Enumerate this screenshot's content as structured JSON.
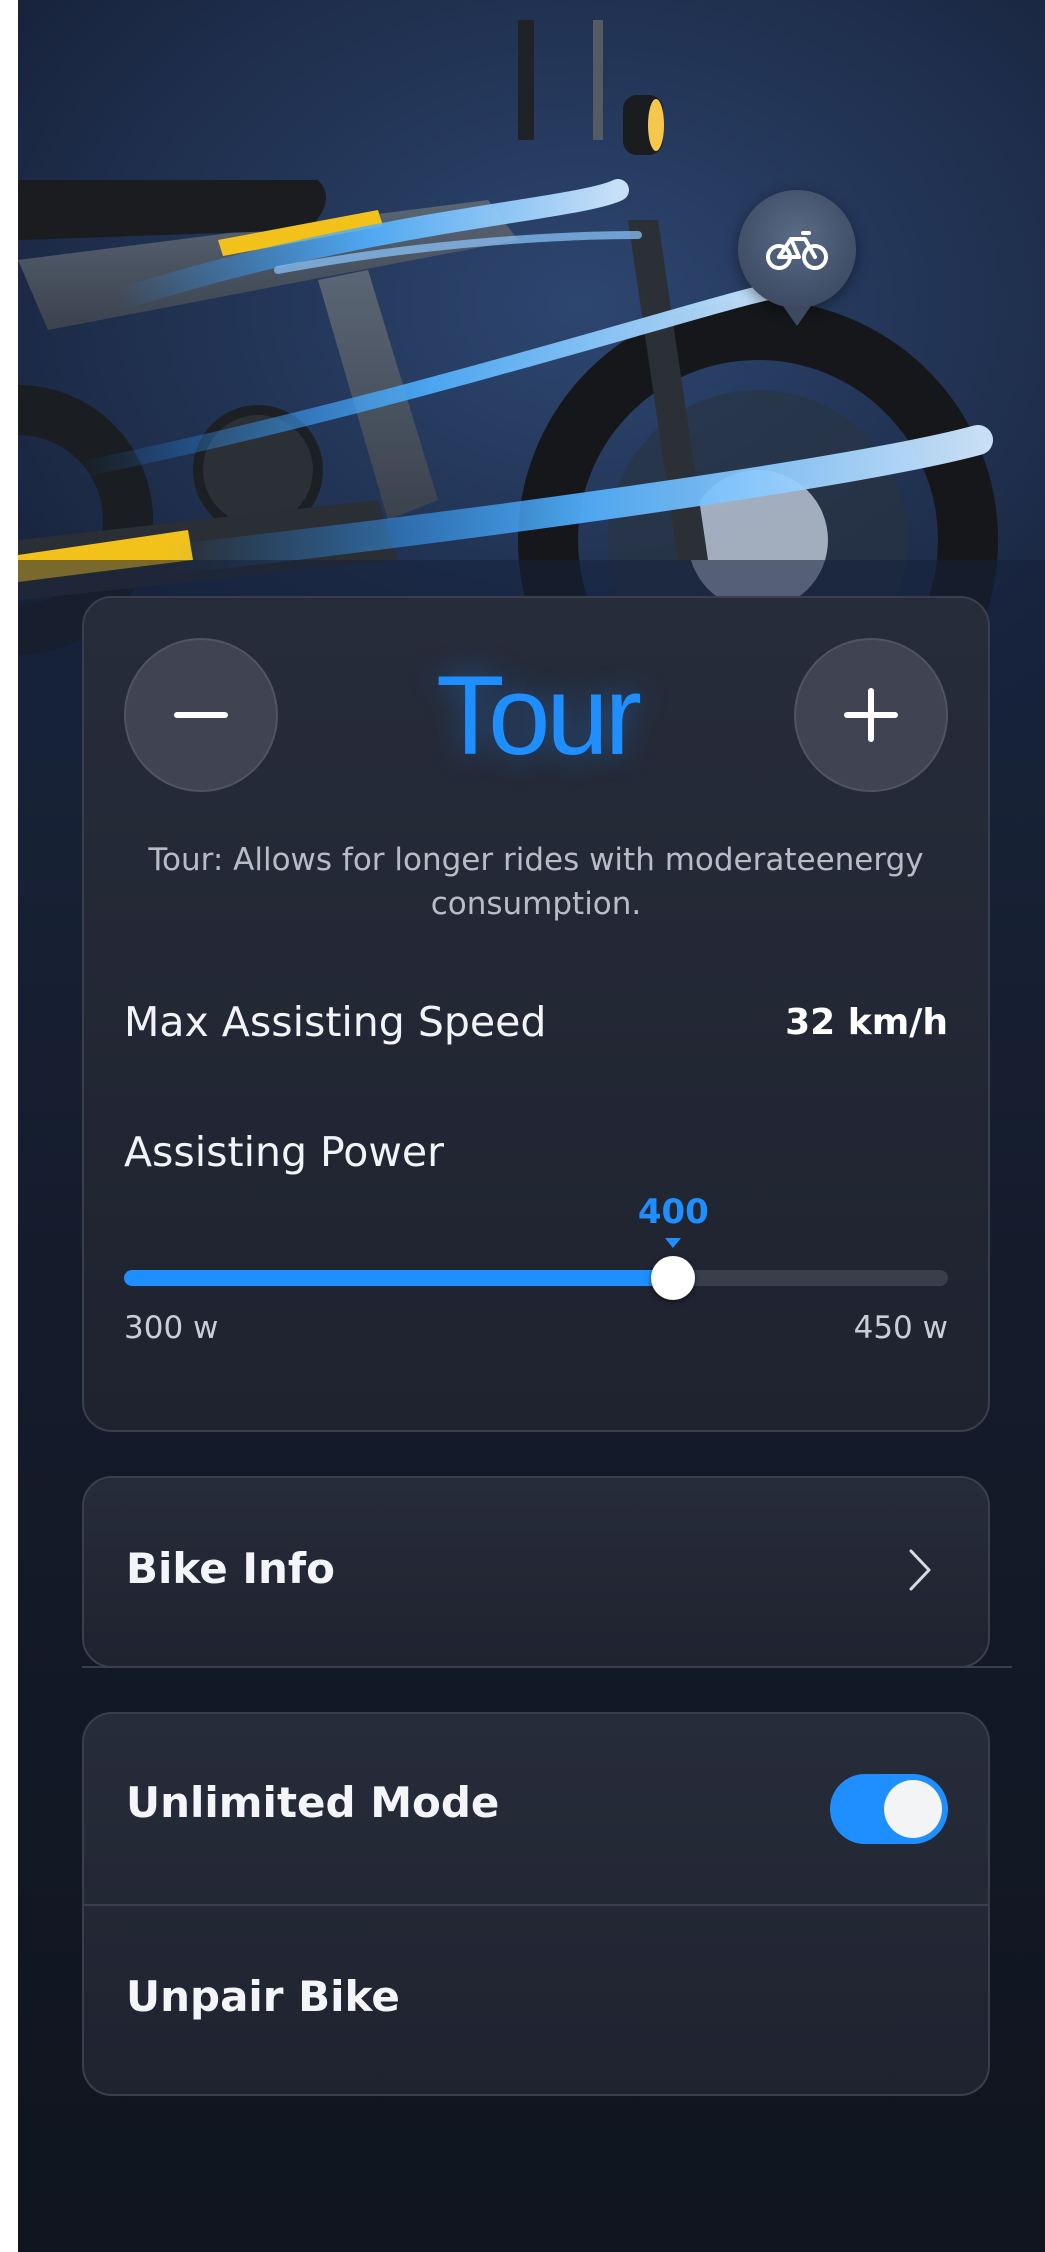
{
  "mode": {
    "name": "Tour",
    "description": "Tour: Allows for longer rides with moderateenergy consumption.",
    "max_speed_label": "Max Assisting Speed",
    "max_speed_value": "32 km/h",
    "power_label": "Assisting Power",
    "power_value": "400",
    "power_min_label": "300 w",
    "power_max_label": "450 w",
    "power_min": 300,
    "power_max": 450,
    "power_current": 400
  },
  "menu": {
    "bike_info": "Bike Info",
    "unlimited_mode": "Unlimited Mode",
    "unlimited_mode_on": true,
    "unpair_bike": "Unpair Bike"
  },
  "icons": {
    "decrease": "minus-icon",
    "increase": "plus-icon",
    "bike_pin": "bicycle-icon",
    "chevron": "chevron-right-icon"
  },
  "colors": {
    "accent": "#1f8fff",
    "background": "#141b2a",
    "card": "#232836",
    "bike_accent": "#f2c21b"
  }
}
